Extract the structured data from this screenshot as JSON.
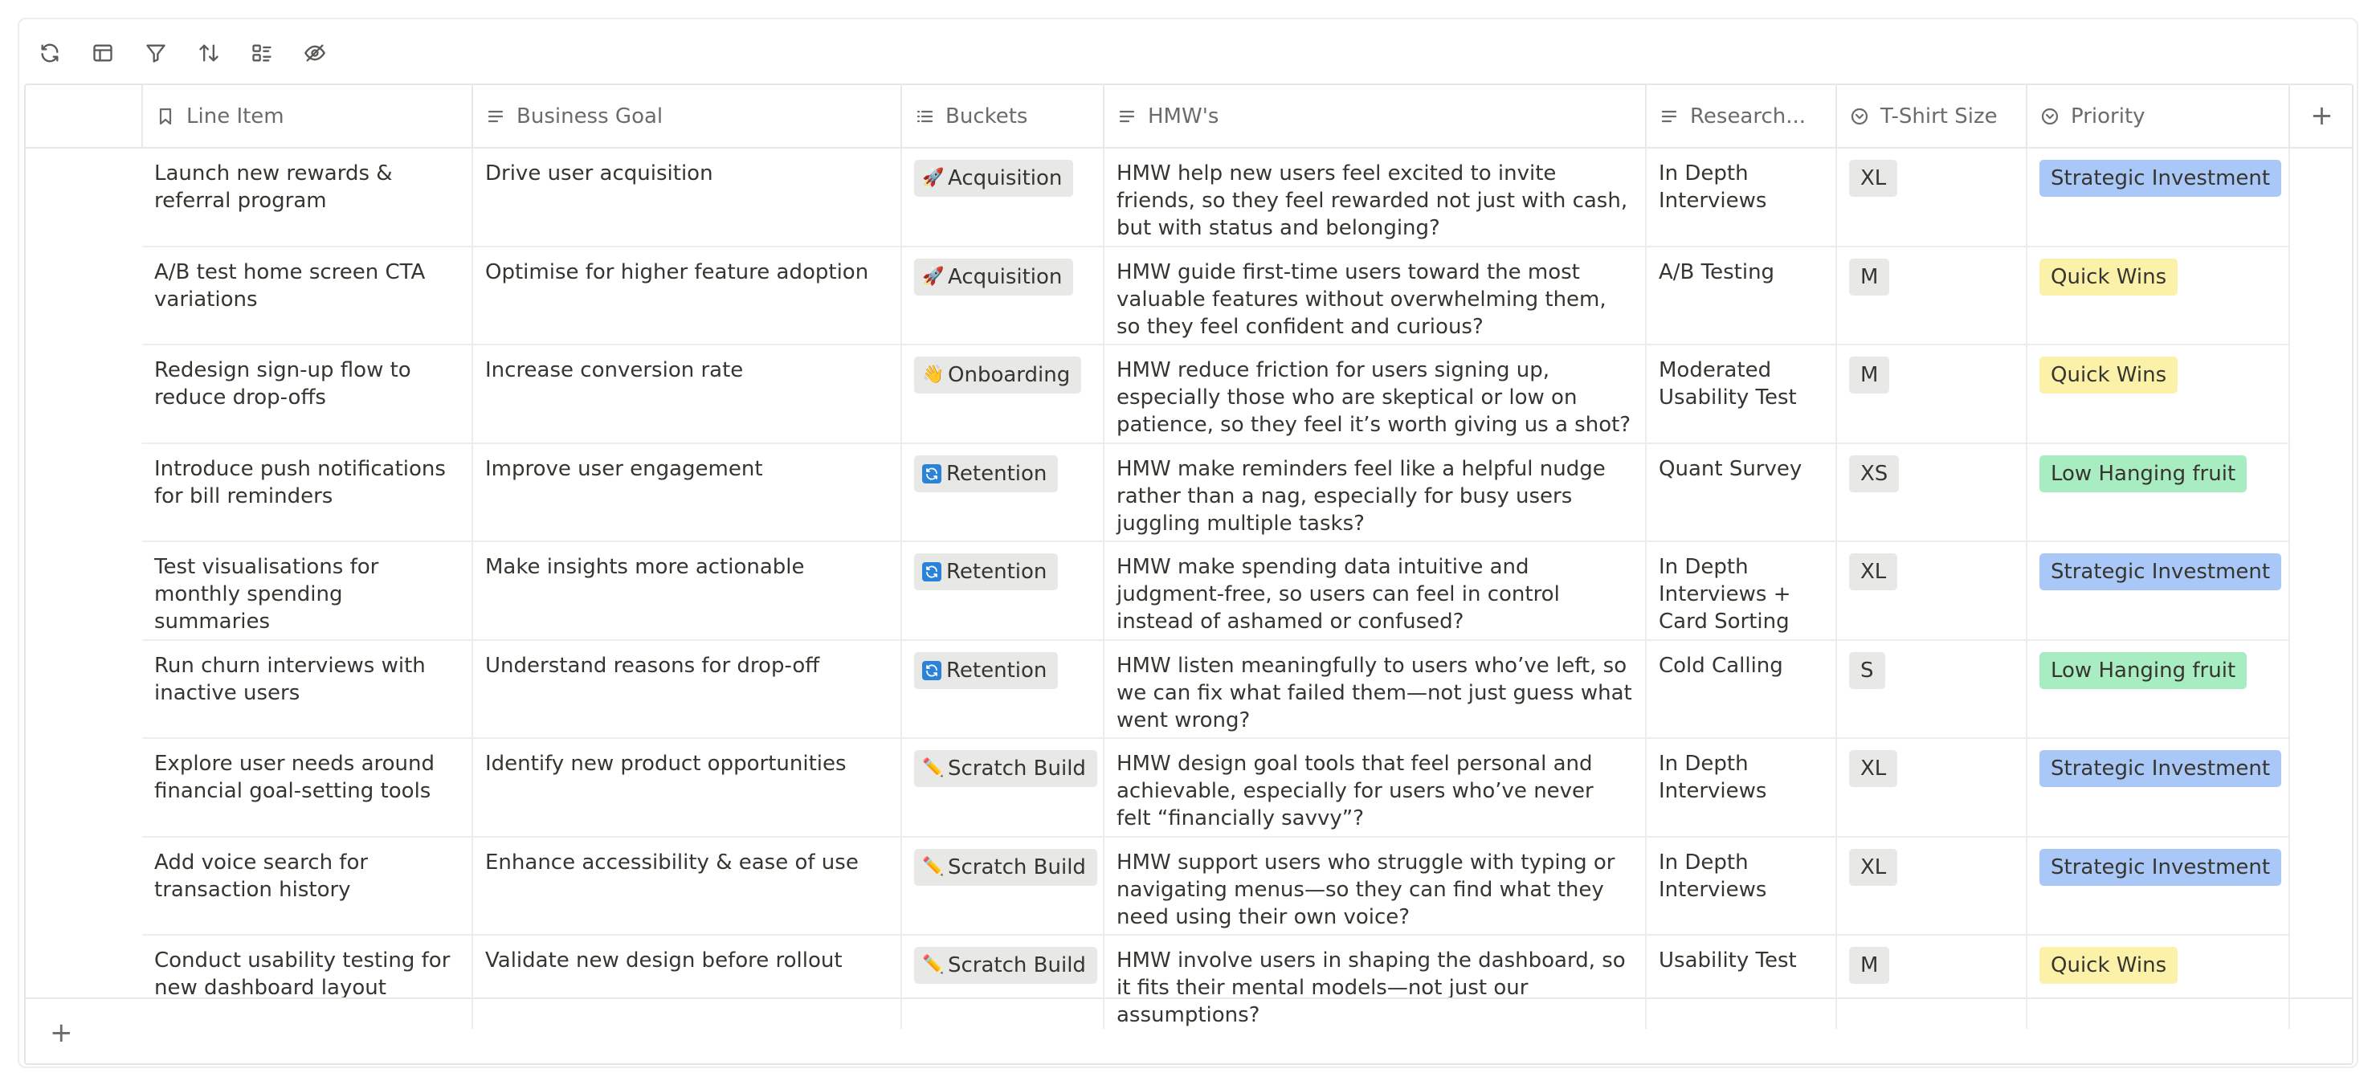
{
  "columns": [
    {
      "key": "line_item",
      "label": "Line Item",
      "icon": "bookmark-icon"
    },
    {
      "key": "business_goal",
      "label": "Business Goal",
      "icon": "text-lines-icon"
    },
    {
      "key": "buckets",
      "label": "Buckets",
      "icon": "list-icon"
    },
    {
      "key": "hmw",
      "label": "HMW's",
      "icon": "text-lines-icon"
    },
    {
      "key": "research",
      "label": "Research...",
      "icon": "text-lines-icon"
    },
    {
      "key": "tshirt",
      "label": "T-Shirt Size",
      "icon": "select-icon"
    },
    {
      "key": "priority",
      "label": "Priority",
      "icon": "select-icon"
    }
  ],
  "colors": {
    "priority": {
      "Strategic Investment": "#a9c8f7",
      "Quick Wins": "#fbf1a9",
      "Low Hanging fruit": "#a8ecc1"
    },
    "bucket_bg": "#e8e8e6"
  },
  "bucket_icons": {
    "Acquisition": "🚀",
    "Onboarding": "👋",
    "Retention": "retention-icon",
    "Scratch Build": "✏️"
  },
  "rows": [
    {
      "line_item": "Launch new rewards & referral program",
      "business_goal": "Drive user acquisition",
      "bucket": "Acquisition",
      "hmw": "HMW help new users feel excited to invite friends, so they feel rewarded not just with cash, but with status and belonging?",
      "research": "In Depth Interviews",
      "tshirt": "XL",
      "priority": "Strategic Investment"
    },
    {
      "line_item": "A/B test home screen CTA variations",
      "business_goal": "Optimise for higher feature adoption",
      "bucket": "Acquisition",
      "hmw": "HMW guide first-time users toward the most valuable features without overwhelming them, so they feel confident and curious?",
      "research": "A/B Testing",
      "tshirt": "M",
      "priority": "Quick Wins"
    },
    {
      "line_item": "Redesign sign-up flow to reduce drop-offs",
      "business_goal": "Increase conversion rate",
      "bucket": "Onboarding",
      "hmw": "HMW reduce friction for users signing up, especially those who are skeptical or low on patience, so they feel it’s worth giving us a shot?",
      "research": "Moderated Usability Test",
      "tshirt": "M",
      "priority": "Quick Wins"
    },
    {
      "line_item": "Introduce push notifications for bill reminders",
      "business_goal": "Improve user engagement",
      "bucket": "Retention",
      "hmw": "HMW make reminders feel like a helpful nudge rather than a nag, especially for busy users juggling multiple tasks?",
      "research": "Quant Survey",
      "tshirt": "XS",
      "priority": "Low Hanging fruit"
    },
    {
      "line_item": "Test visualisations for monthly spending summaries",
      "business_goal": "Make insights more actionable",
      "bucket": "Retention",
      "hmw": "HMW make spending data intuitive and judgment-free, so users can feel in control instead of ashamed or confused?",
      "research": "In Depth Interviews + Card Sorting",
      "tshirt": "XL",
      "priority": "Strategic Investment"
    },
    {
      "line_item": "Run churn interviews with inactive users",
      "business_goal": "Understand reasons for drop-off",
      "bucket": "Retention",
      "hmw": "HMW listen meaningfully to users who’ve left, so we can fix what failed them—not just guess what went wrong?",
      "research": "Cold Calling",
      "tshirt": "S",
      "priority": "Low Hanging fruit"
    },
    {
      "line_item": "Explore user needs around financial goal-setting tools",
      "business_goal": "Identify new product opportunities",
      "bucket": "Scratch Build",
      "hmw": "HMW design goal tools that feel personal and achievable, especially for users who’ve never felt “financially savvy”?",
      "research": "In Depth Interviews",
      "tshirt": "XL",
      "priority": "Strategic Investment"
    },
    {
      "line_item": "Add voice search for transaction history",
      "business_goal": "Enhance accessibility & ease of use",
      "bucket": "Scratch Build",
      "hmw": "HMW support users who struggle with typing or navigating menus—so they can find what they need using their own voice?",
      "research": "In Depth Interviews",
      "tshirt": "XL",
      "priority": "Strategic Investment"
    },
    {
      "line_item": "Conduct usability testing for new dashboard layout",
      "business_goal": "Validate new design before rollout",
      "bucket": "Scratch Build",
      "hmw": "HMW involve users in shaping the dashboard, so it fits their mental models—not just our assumptions?",
      "research": "Usability Test",
      "tshirt": "M",
      "priority": "Quick Wins"
    }
  ],
  "toolbar": {
    "icons": [
      "refresh-icon",
      "layout-icon",
      "filter-icon",
      "sort-icon",
      "group-icon",
      "hide-fields-icon"
    ]
  },
  "add_column_label": "+",
  "add_row_label": "+"
}
